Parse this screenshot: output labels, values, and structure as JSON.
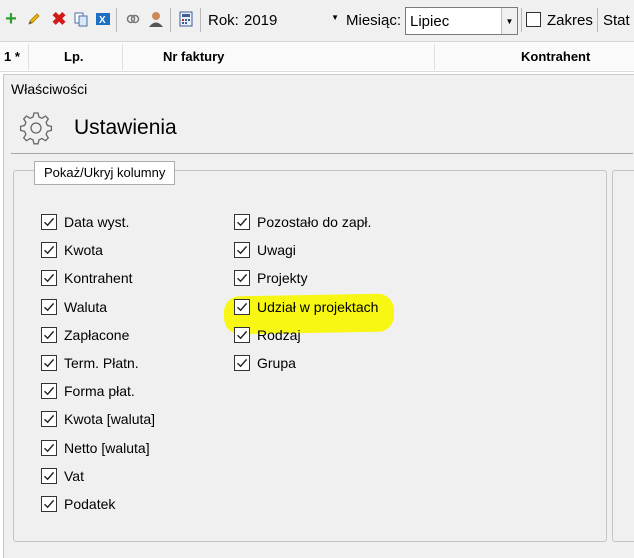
{
  "toolbar": {
    "icons": [
      "add-icon",
      "edit-icon",
      "delete-icon",
      "copy-icon",
      "excel-icon",
      "link-icon",
      "user-icon",
      "calculator-icon"
    ],
    "rok_label": "Rok:",
    "rok_value": "2019",
    "miesiac_label": "Miesiąc:",
    "miesiac_value": "Lipiec",
    "zakres_label": "Zakres",
    "zakres_checked": false,
    "stat_label": "Stat"
  },
  "grid": {
    "columns": [
      "1 *",
      "Lp.",
      "Nr faktury",
      "Kontrahent"
    ]
  },
  "properties": {
    "title": "Właściwości",
    "settings_title": "Ustawienia",
    "group_button": "Pokaż/Ukryj kolumny",
    "columns_left": [
      {
        "label": "Data wyst.",
        "checked": true
      },
      {
        "label": "Kwota",
        "checked": true
      },
      {
        "label": "Kontrahent",
        "checked": true
      },
      {
        "label": "Waluta",
        "checked": true
      },
      {
        "label": "Zapłacone",
        "checked": true
      },
      {
        "label": "Term. Płatn.",
        "checked": true
      },
      {
        "label": "Forma płat.",
        "checked": true
      },
      {
        "label": "Kwota [waluta]",
        "checked": true
      },
      {
        "label": "Netto [waluta]",
        "checked": true
      },
      {
        "label": "Vat",
        "checked": true
      },
      {
        "label": "Podatek",
        "checked": true
      }
    ],
    "columns_right": [
      {
        "label": "Pozostało do zapł.",
        "checked": true
      },
      {
        "label": "Uwagi",
        "checked": true
      },
      {
        "label": "Projekty",
        "checked": true
      },
      {
        "label": "Udział w projektach",
        "checked": true,
        "highlighted": true
      },
      {
        "label": "Rodzaj",
        "checked": true
      },
      {
        "label": "Grupa",
        "checked": true
      }
    ],
    "highlight_color": "#f7f713"
  }
}
